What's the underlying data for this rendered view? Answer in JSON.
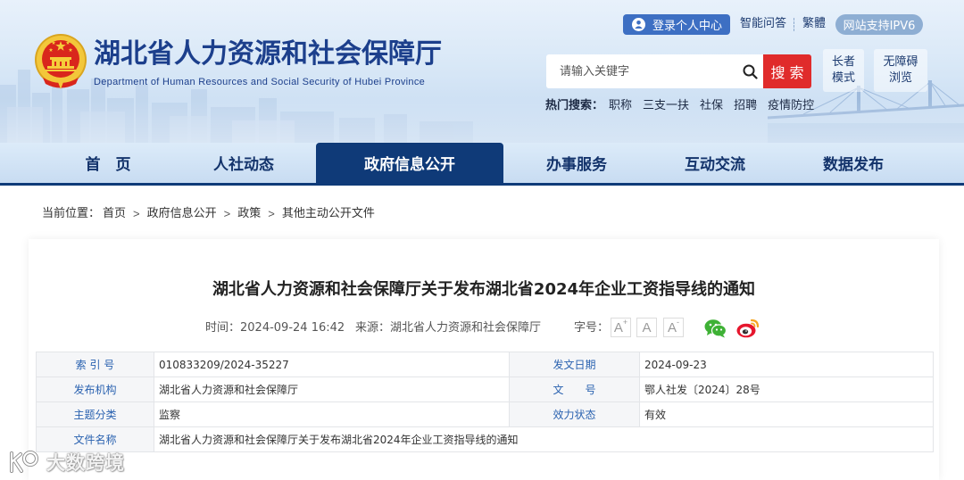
{
  "header": {
    "title": "湖北省人力资源和社会保障厅",
    "subtitle": "Department of Human Resources and Social Security of Hubei Province",
    "emblem_icon": "national-emblem",
    "top_links": {
      "login_label": "登录个人中心",
      "login_icon": "user-circle-icon",
      "qa_label": "智能问答",
      "traditional_label": "繁體",
      "ipv6_label": "网站支持IPV6"
    },
    "search": {
      "placeholder": "请输入关键字",
      "icon": "search-icon",
      "button_label": "搜 索"
    },
    "elder_mode": {
      "line1": "长者",
      "line2": "模式"
    },
    "accessibility": {
      "line1": "无障碍",
      "line2": "浏览"
    },
    "hot_search": {
      "label": "热门搜索：",
      "items": [
        "职称",
        "三支一扶",
        "社保",
        "招聘",
        "疫情防控"
      ]
    }
  },
  "nav": {
    "items": [
      {
        "label": "首　页",
        "active": false
      },
      {
        "label": "人社动态",
        "active": false
      },
      {
        "label": "政府信息公开",
        "active": true
      },
      {
        "label": "办事服务",
        "active": false
      },
      {
        "label": "互动交流",
        "active": false
      },
      {
        "label": "数据发布",
        "active": false
      }
    ]
  },
  "breadcrumb": {
    "label": "当前位置：",
    "separator": ">",
    "items": [
      "首页",
      "政府信息公开",
      "政策",
      "其他主动公开文件"
    ]
  },
  "article": {
    "title": "湖北省人力资源和社会保障厅关于发布湖北省2024年企业工资指导线的通知",
    "time_label": "时间：",
    "time": "2024-09-24 16:42",
    "source_label": "来源：",
    "source": "湖北省人力资源和社会保障厅",
    "font_size_label": "字号：",
    "font_size_options": [
      {
        "letter": "A",
        "mark": "+"
      },
      {
        "letter": "A",
        "mark": ""
      },
      {
        "letter": "A",
        "mark": "-"
      }
    ],
    "share": {
      "wechat_icon": "wechat-icon",
      "weibo_icon": "weibo-icon"
    }
  },
  "meta_table": {
    "rows": [
      {
        "label1": "索 引 号",
        "value1": "010833209/2024-35227",
        "label2": "发文日期",
        "value2": "2024-09-23"
      },
      {
        "label1": "发布机构",
        "value1": "湖北省人力资源和社会保障厅",
        "label2": "文　　号",
        "value2": "鄂人社发〔2024〕28号"
      },
      {
        "label1": "主题分类",
        "value1": "监察",
        "label2": "效力状态",
        "value2": "有效"
      },
      {
        "label1": "文件名称",
        "value1": "湖北省人力资源和社会保障厅关于发布湖北省2024年企业工资指导线的通知"
      }
    ]
  },
  "watermark": {
    "text": "大数跨境",
    "logo_icon": "watermark-logo-icon"
  },
  "colors": {
    "accent": "#0f3a78",
    "search_red": "#e02b2b",
    "label_blue": "#2a62b0",
    "title_blue": "#1c3f8c",
    "login_blue": "#3d6fc3",
    "ipv6_bg": "#8eaed3",
    "wechat": "#3eb135",
    "weibo": "#e6162d"
  }
}
